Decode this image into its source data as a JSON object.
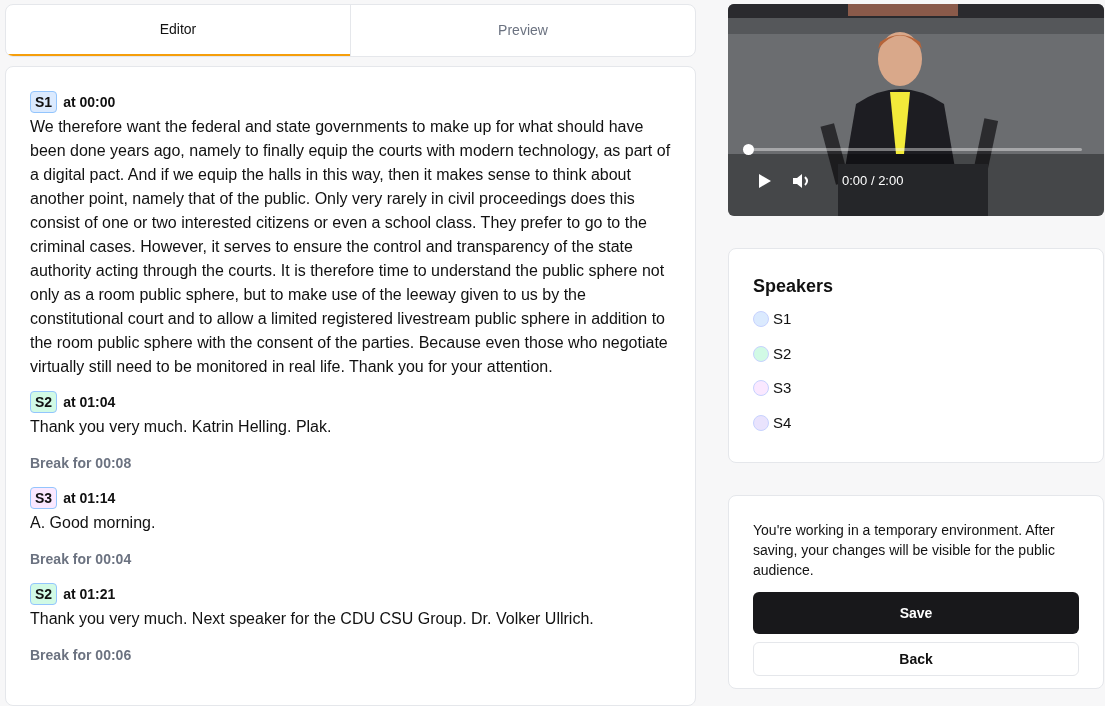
{
  "tabs": [
    {
      "label": "Editor",
      "selected": true
    },
    {
      "label": "Preview",
      "selected": false
    }
  ],
  "transcript": [
    {
      "kind": "speech",
      "speaker": "S1",
      "color": "#dbeafe",
      "time": "at 00:00",
      "text": "We therefore want the federal and state governments to make up for what should have been done years ago, namely to finally equip the courts with modern technology, as part of a digital pact. And if we equip the halls in this way, then it makes sense to think about another point, namely that of the public. Only very rarely in civil proceedings does this consist of one or two interested citizens or even a school class. They prefer to go to the criminal cases. However, it serves to ensure the control and transparency of the state authority acting through the courts. It is therefore time to understand the public sphere not only as a room public sphere, but to make use of the leeway given to us by the constitutional court and to allow a limited registered livestream public sphere in addition to the room public sphere with the consent of the parties. Because even those who negotiate virtually still need to be monitored in real life. Thank you for your attention."
    },
    {
      "kind": "speech",
      "speaker": "S2",
      "color": "#d1fae5",
      "time": "at 01:04",
      "text": "Thank you very much. Katrin Helling. Plak."
    },
    {
      "kind": "break",
      "text": "Break for 00:08"
    },
    {
      "kind": "speech",
      "speaker": "S3",
      "color": "#fae8ff",
      "time": "at 01:14",
      "text": "A. Good morning."
    },
    {
      "kind": "break",
      "text": "Break for 00:04"
    },
    {
      "kind": "speech",
      "speaker": "S2",
      "color": "#d1fae5",
      "time": "at 01:21",
      "text": "Thank you very much. Next speaker for the CDU CSU Group. Dr. Volker Ullrich."
    },
    {
      "kind": "break",
      "text": "Break for 00:06"
    }
  ],
  "video": {
    "kind": "picture",
    "time": "0:00 / 2:00",
    "progress": {
      "level": 0
    }
  },
  "speakers": {
    "title": "Speakers",
    "items": [
      {
        "label": "S1",
        "color": "#dbeafe"
      },
      {
        "label": "S2",
        "color": "#d1fae5"
      },
      {
        "label": "S3",
        "color": "#fae8ff"
      },
      {
        "label": "S4",
        "color": "#e9e3fd"
      }
    ]
  },
  "notice": {
    "text": "You're working in a temporary environment. After saving, your changes will be visible for the public audience.",
    "buttons": [
      {
        "kind": "primary",
        "label": "Save"
      },
      {
        "kind": "secondary",
        "label": "Back"
      }
    ]
  }
}
